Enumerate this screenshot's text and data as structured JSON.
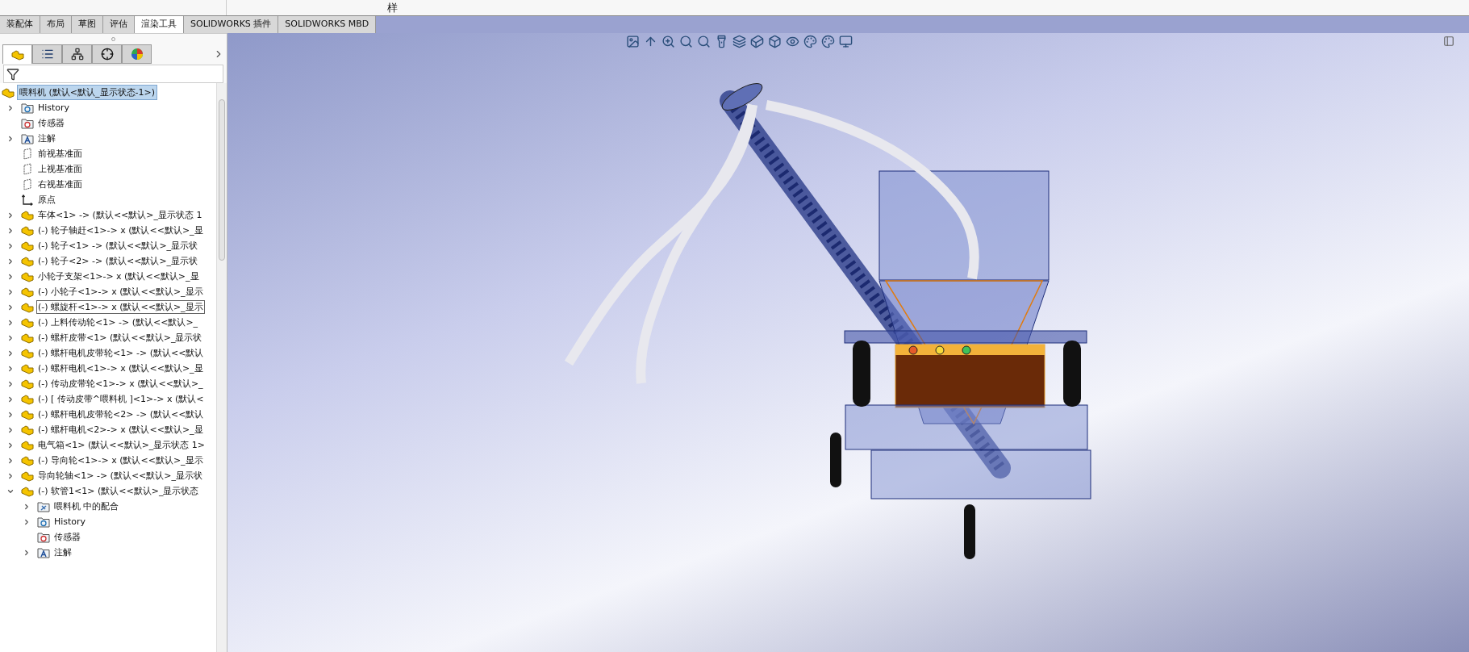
{
  "title_fragment": "样",
  "command_tabs": [
    {
      "label": "装配体",
      "selected": false
    },
    {
      "label": "布局",
      "selected": false
    },
    {
      "label": "草图",
      "selected": false
    },
    {
      "label": "评估",
      "selected": false
    },
    {
      "label": "渲染工具",
      "selected": true
    },
    {
      "label": "SOLIDWORKS 插件",
      "selected": false
    },
    {
      "label": "SOLIDWORKS MBD",
      "selected": false
    }
  ],
  "panel_tabs": [
    {
      "kind": "feature",
      "selected": true
    },
    {
      "kind": "property",
      "selected": false
    },
    {
      "kind": "config",
      "selected": false
    },
    {
      "kind": "dimxpert",
      "selected": false
    },
    {
      "kind": "display",
      "selected": false
    }
  ],
  "tree": {
    "label": "喂料机  (默认<默认_显示状态-1>)",
    "selected": true,
    "children": [
      {
        "kind": "history",
        "label": "History",
        "expanded": false,
        "focused": false
      },
      {
        "kind": "sensor",
        "label": "传感器",
        "focused": false
      },
      {
        "kind": "annotation",
        "label": "注解",
        "expanded": false,
        "focused": false
      },
      {
        "kind": "plane",
        "label": "前视基准面",
        "focused": false
      },
      {
        "kind": "plane",
        "label": "上视基准面",
        "focused": false
      },
      {
        "kind": "plane",
        "label": "右视基准面",
        "focused": false
      },
      {
        "kind": "origin",
        "label": "原点",
        "focused": false
      },
      {
        "kind": "part",
        "label": "车体<1> -> (默认<<默认>_显示状态 1",
        "expanded": false,
        "focused": false
      },
      {
        "kind": "part",
        "label": "(-) 轮子轴赶<1>-> x (默认<<默认>_显",
        "expanded": false,
        "focused": false
      },
      {
        "kind": "part",
        "label": "(-) 轮子<1> -> (默认<<默认>_显示状",
        "expanded": false,
        "focused": false
      },
      {
        "kind": "part",
        "label": "(-) 轮子<2> -> (默认<<默认>_显示状",
        "expanded": false,
        "focused": false
      },
      {
        "kind": "part",
        "label": "小轮子支架<1>-> x (默认<<默认>_显",
        "expanded": false,
        "focused": false
      },
      {
        "kind": "part",
        "label": "(-) 小轮子<1>-> x (默认<<默认>_显示",
        "expanded": false,
        "focused": false
      },
      {
        "kind": "part",
        "label": "(-) 螺旋杆<1>-> x (默认<<默认>_显示",
        "expanded": false,
        "focused": true
      },
      {
        "kind": "part",
        "label": "(-) 上料传动轮<1> -> (默认<<默认>_",
        "expanded": false,
        "focused": false
      },
      {
        "kind": "part",
        "label": "(-) 螺杆皮带<1> (默认<<默认>_显示状",
        "expanded": false,
        "focused": false
      },
      {
        "kind": "part",
        "label": "(-) 螺杆电机皮带轮<1> -> (默认<<默认",
        "expanded": false,
        "focused": false
      },
      {
        "kind": "part",
        "label": "(-) 螺杆电机<1>-> x (默认<<默认>_显",
        "expanded": false,
        "focused": false
      },
      {
        "kind": "part",
        "label": "(-) 传动皮带轮<1>-> x (默认<<默认>_",
        "expanded": false,
        "focused": false
      },
      {
        "kind": "part",
        "label": "(-) [ 传动皮带^喂料机 ]<1>-> x (默认<",
        "expanded": false,
        "focused": false
      },
      {
        "kind": "part",
        "label": "(-) 螺杆电机皮带轮<2> -> (默认<<默认",
        "expanded": false,
        "focused": false
      },
      {
        "kind": "part",
        "label": "(-) 螺杆电机<2>-> x (默认<<默认>_显",
        "expanded": false,
        "focused": false
      },
      {
        "kind": "part",
        "label": "电气箱<1> (默认<<默认>_显示状态 1>",
        "expanded": false,
        "focused": false
      },
      {
        "kind": "part",
        "label": "(-) 导向轮<1>-> x (默认<<默认>_显示",
        "expanded": false,
        "focused": false
      },
      {
        "kind": "part",
        "label": "导向轮轴<1> -> (默认<<默认>_显示状",
        "expanded": false,
        "focused": false
      },
      {
        "kind": "part",
        "label": "(-) 软管1<1> (默认<<默认>_显示状态",
        "expanded": true,
        "focused": false,
        "children": [
          {
            "kind": "mates",
            "label": "喂料机 中的配合",
            "expanded": false,
            "focused": false
          },
          {
            "kind": "history",
            "label": "History",
            "expanded": false,
            "focused": false
          },
          {
            "kind": "sensor",
            "label": "传感器",
            "focused": false
          },
          {
            "kind": "annotation",
            "label": "注解",
            "expanded": false,
            "focused": false
          }
        ]
      }
    ]
  }
}
